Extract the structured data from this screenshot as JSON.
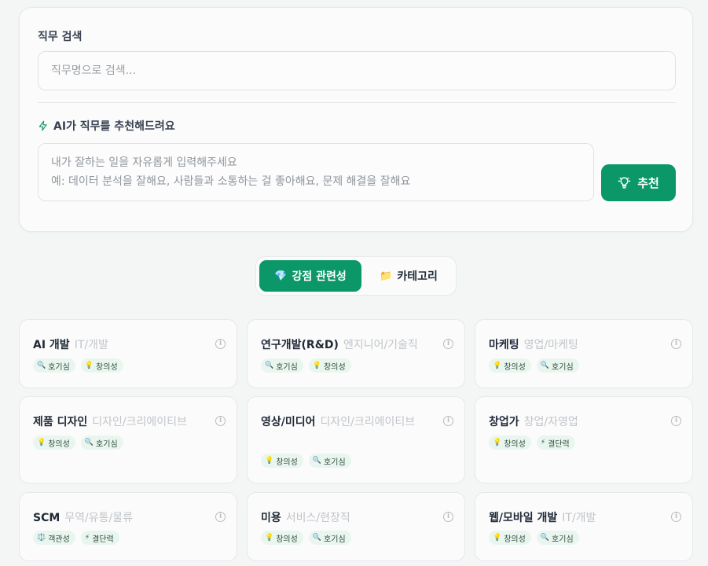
{
  "search": {
    "label": "직무 검색",
    "placeholder": "직무명으로 검색..."
  },
  "ai": {
    "label": "AI가 직무를 추천해드려요",
    "icon": "zap-icon",
    "prompt_placeholder": "내가 잘하는 일을 자유롭게 입력해주세요\n예: 데이터 분석을 잘해요, 사람들과 소통하는 걸 좋아해요, 문제 해결을 잘해요",
    "button_label": "추천",
    "button_icon": "lightbulb-icon"
  },
  "sort_tabs": [
    {
      "label": "강점 관련성",
      "emoji": "💎",
      "active": true
    },
    {
      "label": "카테고리",
      "emoji": "📁",
      "active": false
    }
  ],
  "jobs": [
    {
      "name": "AI 개발",
      "category": "IT/개발",
      "tags": [
        {
          "emoji": "🔍",
          "label": "호기심"
        },
        {
          "emoji": "💡",
          "label": "창의성"
        }
      ]
    },
    {
      "name": "연구개발(R&D)",
      "category": "엔지니어/기술직",
      "tags": [
        {
          "emoji": "🔍",
          "label": "호기심"
        },
        {
          "emoji": "💡",
          "label": "창의성"
        }
      ]
    },
    {
      "name": "마케팅",
      "category": "영업/마케팅",
      "tags": [
        {
          "emoji": "💡",
          "label": "창의성"
        },
        {
          "emoji": "🔍",
          "label": "호기심"
        }
      ]
    },
    {
      "name": "제품 디자인",
      "category": "디자인/크리에이티브",
      "tags": [
        {
          "emoji": "💡",
          "label": "창의성"
        },
        {
          "emoji": "🔍",
          "label": "호기심"
        }
      ]
    },
    {
      "name": "영상/미디어",
      "category": "디자인/크리에이티브",
      "tags": [
        {
          "emoji": "💡",
          "label": "창의성"
        },
        {
          "emoji": "🔍",
          "label": "호기심"
        }
      ]
    },
    {
      "name": "창업가",
      "category": "창업/자영업",
      "tags": [
        {
          "emoji": "💡",
          "label": "창의성"
        },
        {
          "emoji": "⚡",
          "label": "결단력"
        }
      ]
    },
    {
      "name": "SCM",
      "category": "무역/유통/물류",
      "tags": [
        {
          "emoji": "⚖️",
          "label": "객관성"
        },
        {
          "emoji": "⚡",
          "label": "결단력"
        }
      ]
    },
    {
      "name": "미용",
      "category": "서비스/현장직",
      "tags": [
        {
          "emoji": "💡",
          "label": "창의성"
        },
        {
          "emoji": "🔍",
          "label": "호기심"
        }
      ]
    },
    {
      "name": "웹/모바일 개발",
      "category": "IT/개발",
      "tags": [
        {
          "emoji": "💡",
          "label": "창의성"
        },
        {
          "emoji": "🔍",
          "label": "호기심"
        }
      ]
    }
  ],
  "colors": {
    "accent": "#0b9767",
    "tag_bg": "#e9f6ef",
    "category_text": "#c0c4c9"
  }
}
